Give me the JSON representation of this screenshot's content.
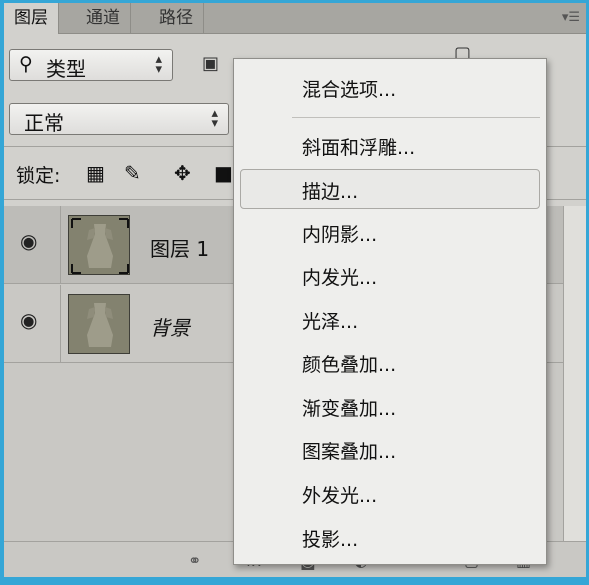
{
  "tabs": [
    {
      "label": "图层"
    },
    {
      "label": "通道"
    },
    {
      "label": "路径"
    }
  ],
  "panel_menu_icon": "panel-menu-icon",
  "filter": {
    "label": "类型",
    "icon": "search-icon"
  },
  "blend_mode": {
    "value": "正常"
  },
  "lock": {
    "label": "锁定:"
  },
  "layers": [
    {
      "name": "图层 1",
      "visible": true,
      "selected": true
    },
    {
      "name": "背景",
      "visible": true,
      "selected": false
    }
  ],
  "context_menu": {
    "items": [
      {
        "label": "混合选项..."
      },
      {
        "label": "斜面和浮雕..."
      },
      {
        "label": "描边...",
        "highlighted": true
      },
      {
        "label": "内阴影..."
      },
      {
        "label": "内发光..."
      },
      {
        "label": "光泽..."
      },
      {
        "label": "颜色叠加..."
      },
      {
        "label": "渐变叠加..."
      },
      {
        "label": "图案叠加..."
      },
      {
        "label": "外发光..."
      },
      {
        "label": "投影..."
      }
    ]
  },
  "colors": {
    "accent_border": "#35a6d6",
    "panel": "#d2d1cd",
    "menu": "#eeeeec"
  }
}
